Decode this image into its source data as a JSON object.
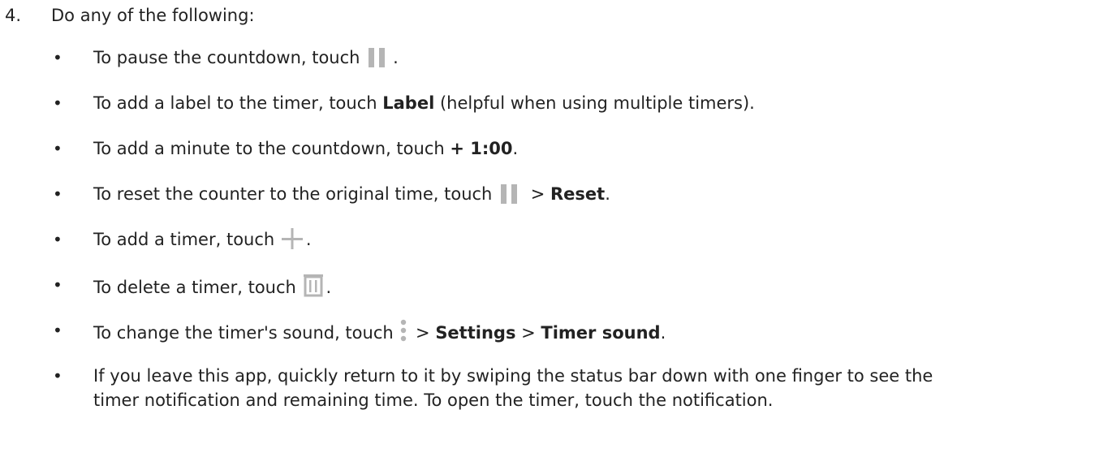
{
  "step": {
    "number": "4.",
    "text": "Do any of the following:"
  },
  "bullet_char": "•",
  "bullets": {
    "pause": {
      "before": "To pause the countdown, touch ",
      "icon": "pause-icon",
      "after": "."
    },
    "label": {
      "before": "To add a label to the timer, touch ",
      "bold": "Label",
      "after": " (helpful when using multiple timers)."
    },
    "add_minute": {
      "before": "To add a minute to the countdown, touch ",
      "bold": "+ 1:00",
      "after": "."
    },
    "reset": {
      "before": "To reset the counter to the original time, touch ",
      "icon": "pause-icon",
      "sep": " > ",
      "bold": "Reset",
      "after": "."
    },
    "add_timer": {
      "before": "To add a timer, touch ",
      "icon": "plus-icon",
      "after": "."
    },
    "delete_timer": {
      "before": "To delete a timer, touch ",
      "icon": "trash-icon",
      "after": "."
    },
    "sound": {
      "before": "To change the timer's sound, touch ",
      "icon": "more-vert-icon",
      "sep1": " > ",
      "bold1": "Settings",
      "sep2": " > ",
      "bold2": "Timer sound",
      "after": "."
    },
    "leave_app": {
      "line1": "If you leave this app, quickly return to it by swiping the status bar down with one finger to see the",
      "line2": "timer notification and remaining time. To open the timer, touch the notification."
    }
  },
  "colors": {
    "text": "#222222",
    "icon": "#b5b5b5"
  }
}
